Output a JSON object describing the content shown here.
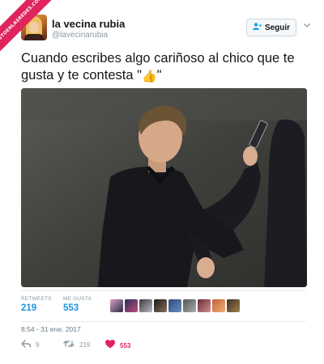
{
  "watermark": {
    "text": "VISTOENLASREDES.COM"
  },
  "tweet": {
    "author_name": "la vecina rubia",
    "author_handle": "@lavecinarubia",
    "follow_label": "Seguir",
    "text": "Cuando escribes algo cariñoso al chico que te gusta y te contesta \"",
    "text_emoji": "👍",
    "text_end": "\"",
    "retweets_label": "RETWEETS",
    "retweets_count": "219",
    "likes_label": "ME GUSTA",
    "likes_count": "553",
    "timestamp": "8:54 - 31 ene. 2017",
    "actions": {
      "reply_count": "9",
      "retweet_count": "219",
      "like_count": "553"
    }
  },
  "icons": {
    "follow": "add-user-icon",
    "chevron": "chevron-down-icon",
    "reply": "reply-icon",
    "retweet": "retweet-icon",
    "like": "heart-icon"
  },
  "colors": {
    "accent": "#1b95e0",
    "like": "#e0245e",
    "muted": "#8899a6"
  }
}
